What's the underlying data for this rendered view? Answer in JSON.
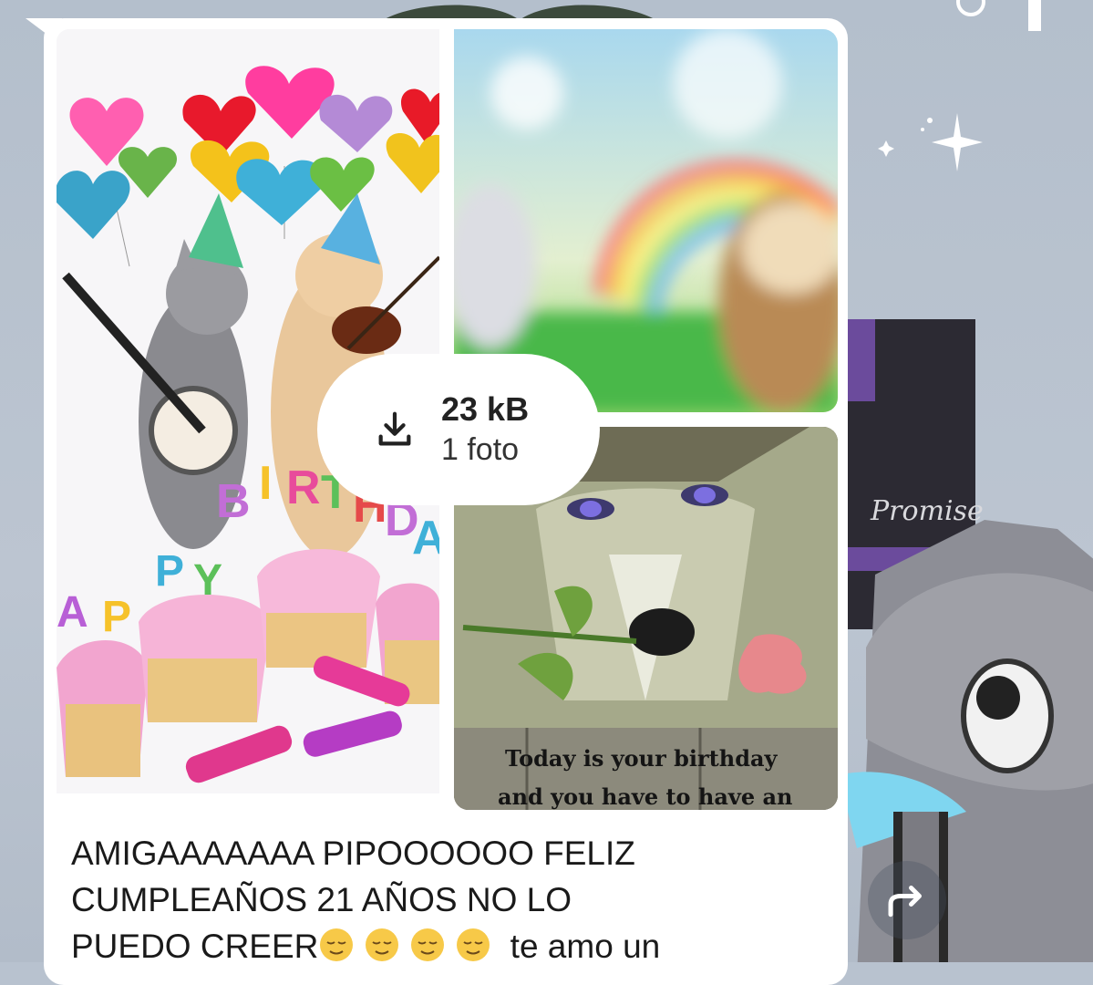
{
  "message": {
    "media": {
      "download_size": "23 kB",
      "download_count": "1 foto",
      "wolf_image_text_line1": "Today is your birthday",
      "wolf_image_text_line2": "and you have to have an",
      "balloon_letters": [
        "B",
        "I",
        "R",
        "T",
        "H",
        "D",
        "A",
        "Y"
      ],
      "candle_letters": [
        "P",
        "P",
        "Y"
      ]
    },
    "caption_line1": "AMIGAAAAAAA PIPOOOOOO FELIZ",
    "caption_line2": "CUMPLEAÑOS 21 AÑOS NO LO",
    "caption_line3_start": "PUEDO CREER",
    "caption_line3_end": " te amo un"
  },
  "wallpaper": {
    "watermark_text": "Promise"
  },
  "icons": {
    "download": "download-icon",
    "forward": "forward-icon",
    "emoji": "relieved-face-emoji"
  },
  "colors": {
    "bubble": "#ffffff",
    "wallpaper": "#b8c2cf",
    "text": "#1a1a1a"
  }
}
